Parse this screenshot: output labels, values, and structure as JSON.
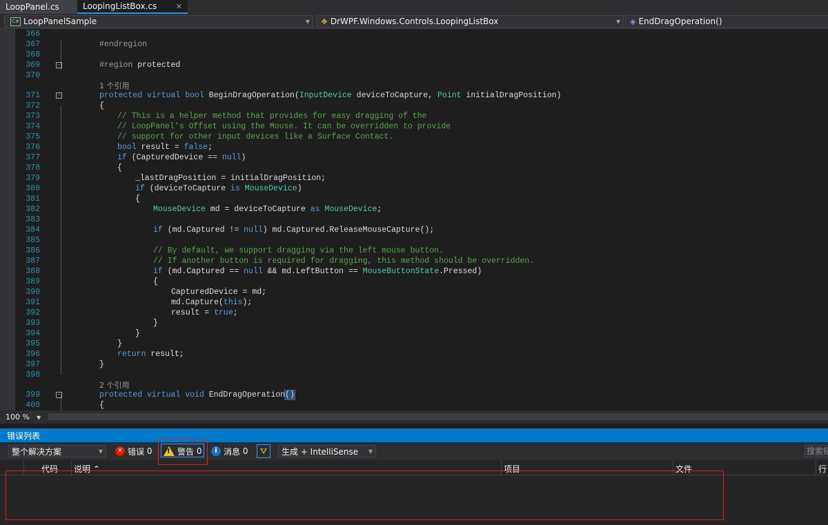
{
  "tabs": [
    {
      "label": "LoopPanel.cs"
    },
    {
      "label": "LoopingListBox.cs"
    }
  ],
  "nav": {
    "project": "LoopPanelSample",
    "class": "DrWPF.Windows.Controls.LoopingListBox",
    "member": "EndDragOperation()"
  },
  "code": {
    "ln": [
      "366",
      "367",
      "368",
      "369",
      "370",
      "371",
      "372",
      "373",
      "374",
      "375",
      "376",
      "377",
      "378",
      "379",
      "380",
      "381",
      "382",
      "383",
      "384",
      "385",
      "386",
      "387",
      "388",
      "389",
      "390",
      "391",
      "392",
      "393",
      "394",
      "395",
      "396",
      "397",
      "398",
      "399",
      "400"
    ],
    "refs1": "1 个引用",
    "refs2": "2 个引用",
    "l367": "#endregion",
    "l369_kw": "#region",
    "l369_rest": " protected",
    "l371": {
      "kw": "protected virtual bool",
      "name": " BeginDragOperation(",
      "t1": "InputDevice",
      "p1": " deviceToCapture, ",
      "t2": "Point",
      "p2": " initialDragPosition)"
    },
    "l372": "{",
    "l373": "// This is a helper method that provides for easy dragging of the",
    "l374": "// LoopPanel's Offset using the Mouse. It can be overridden to provide",
    "l375": "// support for other input devices like a Surface Contact.",
    "l376": {
      "kw": "bool",
      "mid": " result = ",
      "kw2": "false",
      "end": ";"
    },
    "l377": {
      "kw": "if",
      "mid": " (CapturedDevice == ",
      "kw2": "null",
      "end": ")"
    },
    "l378": "{",
    "l379": "_lastDragPosition = initialDragPosition;",
    "l380": {
      "kw": "if",
      "mid": " (deviceToCapture ",
      "kw2": "is",
      "sp": " ",
      "ty": "MouseDevice",
      "end": ")"
    },
    "l381": "{",
    "l382": {
      "ty": "MouseDevice",
      "mid": " md = deviceToCapture ",
      "kw": "as",
      "sp": " ",
      "ty2": "MouseDevice",
      "end": ";"
    },
    "l384": {
      "kw": "if",
      "mid": " (md.Captured != ",
      "kw2": "null",
      "end": ") md.Captured.ReleaseMouseCapture();"
    },
    "l386": "// By default, we support dragging via the left mouse button.",
    "l387": "// If another button is required for dragging, this method should be overridden.",
    "l388": {
      "kw": "if",
      "mid": " (md.Captured == ",
      "kw2": "null",
      "mid2": " && md.LeftButton == ",
      "ty": "MouseButtonState",
      "end": ".Pressed)"
    },
    "l389": "{",
    "l390": "CapturedDevice = md;",
    "l391": {
      "a": "md.Capture(",
      "kw": "this",
      "b": ");"
    },
    "l392": {
      "a": "result = ",
      "kw": "true",
      "b": ";"
    },
    "l393": "}",
    "l394": "}",
    "l395": "}",
    "l396": {
      "kw": "return",
      "b": " result;"
    },
    "l397": "}",
    "l399": {
      "kw": "protected virtual void",
      "name": " EndDragOperation",
      "paren": "()"
    },
    "l400": "{"
  },
  "zoom": "100 %",
  "errorlist": {
    "title": "错误列表",
    "scope": "整个解决方案",
    "errors_label": "错误",
    "errors_count": "0",
    "warnings_label": "警告",
    "warnings_count": "0",
    "messages_label": "消息",
    "messages_count": "0",
    "build_filter": "生成 + IntelliSense",
    "search_placeholder": "搜索错",
    "columns": [
      "代码",
      "说明",
      "项目",
      "文件",
      "行"
    ]
  },
  "colors": {
    "accent": "#007acc",
    "keyword": "#569cd6",
    "type": "#4ec9b0",
    "comment": "#57a64a"
  }
}
